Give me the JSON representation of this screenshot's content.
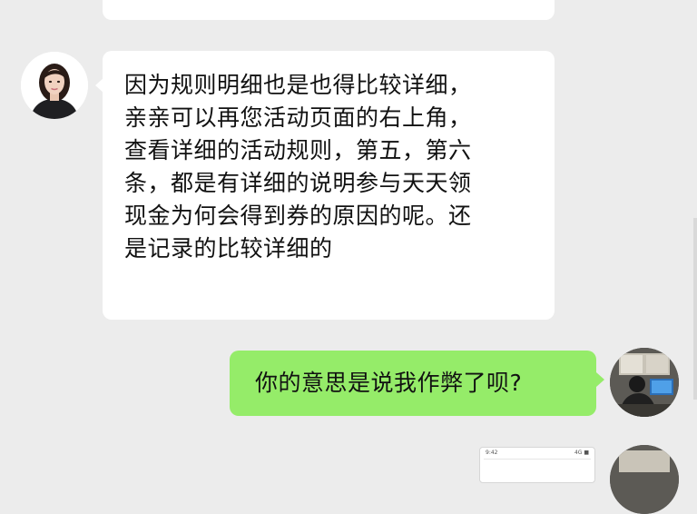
{
  "messages": [
    {
      "id": "top-partial",
      "direction": "incoming",
      "text": ""
    },
    {
      "id": "agent-reply",
      "direction": "incoming",
      "text": "因为规则明细也是也得比较详细，\n亲亲可以再您活动页面的右上角，\n查看详细的活动规则，第五，第六\n条，都是有详细的说明参与天天领\n现金为何会得到券的原因的呢。还\n是记录的比较详细的"
    },
    {
      "id": "user-question",
      "direction": "outgoing",
      "text": "你的意思是说我作弊了呗?"
    }
  ],
  "image_message": {
    "status_time": "9:42",
    "status_right": "4G ■"
  },
  "colors": {
    "background": "#ececec",
    "incoming_bubble": "#ffffff",
    "outgoing_bubble": "#95ec69"
  }
}
